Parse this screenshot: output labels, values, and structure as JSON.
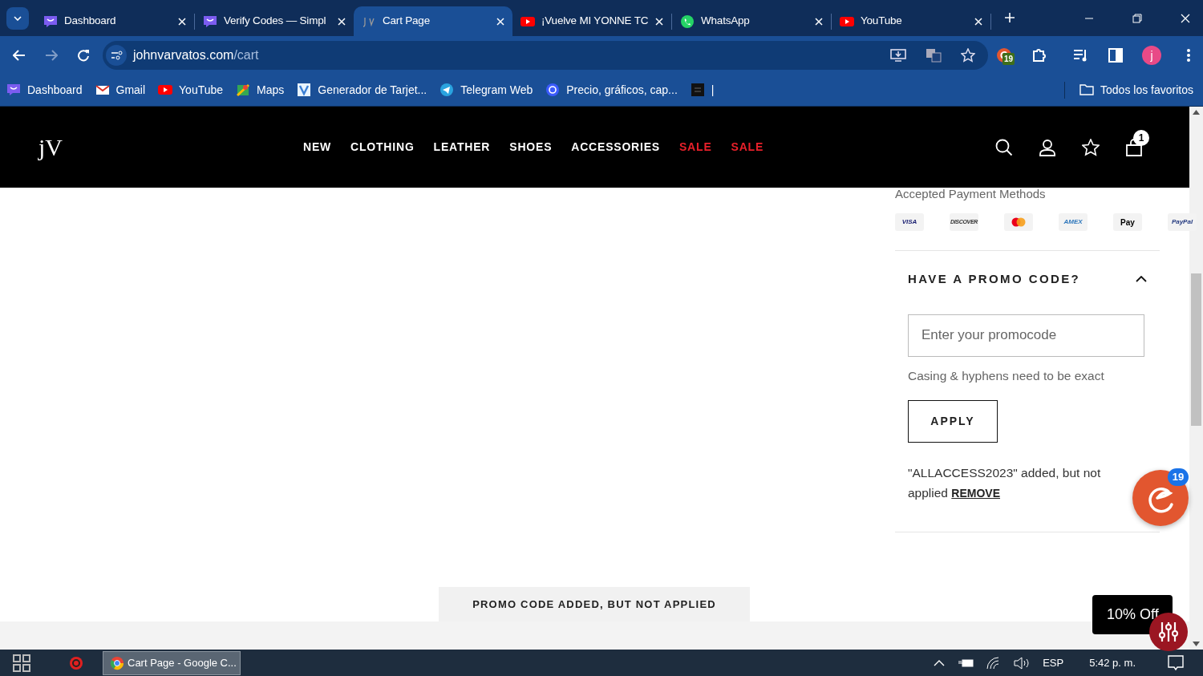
{
  "browser": {
    "tabs": [
      {
        "title": "Dashboard",
        "kind": "purple",
        "selected": false
      },
      {
        "title": "Verify Codes — Simpl",
        "kind": "purple",
        "selected": false
      },
      {
        "title": "Cart Page",
        "kind": "jv",
        "selected": true
      },
      {
        "title": "¡Vuelve MI YONNE TC",
        "kind": "youtube",
        "selected": false
      },
      {
        "title": "WhatsApp",
        "kind": "whatsapp",
        "selected": false
      },
      {
        "title": "YouTube",
        "kind": "youtube",
        "selected": false
      }
    ],
    "address": {
      "host": "johnvarvatos.com",
      "path": "/cart"
    },
    "extension_badge": "19",
    "profile_initial": "j",
    "bookmarks": [
      {
        "title": "Dashboard",
        "kind": "purple"
      },
      {
        "title": "Gmail",
        "kind": "gmail"
      },
      {
        "title": "YouTube",
        "kind": "youtube"
      },
      {
        "title": "Maps",
        "kind": "maps"
      },
      {
        "title": "Generador de Tarjet...",
        "kind": "v"
      },
      {
        "title": "Telegram Web",
        "kind": "telegram"
      },
      {
        "title": "Precio, gráficos, cap...",
        "kind": "coin"
      },
      {
        "title": "|",
        "kind": "dark"
      }
    ],
    "all_bookmarks": "Todos los favoritos"
  },
  "site": {
    "logo": "jV",
    "nav": [
      {
        "label": "NEW",
        "sale": false
      },
      {
        "label": "CLOTHING",
        "sale": false
      },
      {
        "label": "LEATHER",
        "sale": false
      },
      {
        "label": "SHOES",
        "sale": false
      },
      {
        "label": "ACCESSORIES",
        "sale": false
      },
      {
        "label": "SALE",
        "sale": true
      },
      {
        "label": "SALE",
        "sale": true
      }
    ],
    "cart_count": "1"
  },
  "payment": {
    "title": "Accepted Payment Methods",
    "methods": [
      {
        "kind": "visa",
        "label": "VISA"
      },
      {
        "kind": "discover",
        "label": "DISCOVER"
      },
      {
        "kind": "mastercard"
      },
      {
        "kind": "amex",
        "label": "AMEX"
      },
      {
        "kind": "applepay",
        "label": "Pay"
      },
      {
        "kind": "paypal",
        "label": "PayPal"
      }
    ]
  },
  "promo": {
    "title": "HAVE A PROMO CODE?",
    "expanded": true,
    "placeholder": "Enter your promocode",
    "hint": "Casing & hyphens need to be exact",
    "button": "APPLY",
    "message": "\"ALLACCESS2023\" added, but not applied",
    "remove": "REMOVE"
  },
  "toast": "PROMO CODE ADDED, BUT NOT APPLIED",
  "chat_badge": "19",
  "discount_button": "10% Off",
  "taskbar": {
    "window": "Cart Page - Google C...",
    "language": "ESP",
    "time": "5:42 p. m."
  }
}
